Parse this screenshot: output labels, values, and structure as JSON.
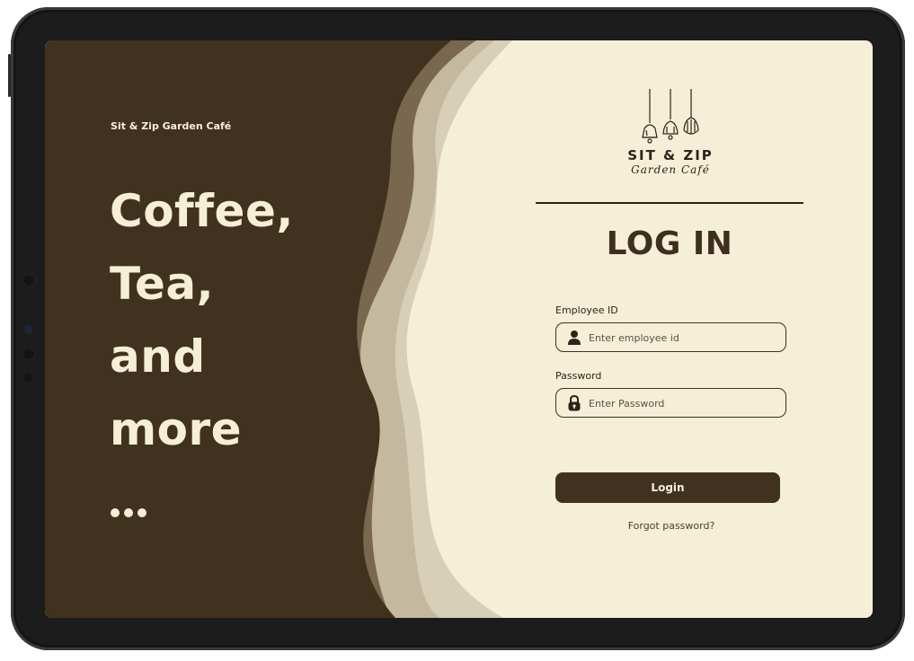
{
  "brand": {
    "name": "Sit & Zip Garden Café"
  },
  "hero": {
    "lines": [
      "Coffee,",
      "Tea,",
      "and",
      "more"
    ]
  },
  "logo": {
    "title": "SIT & ZIP",
    "script": "Garden Café"
  },
  "login": {
    "title": "LOG IN",
    "employee_id": {
      "label": "Employee ID",
      "placeholder": "Enter employee id",
      "value": "",
      "icon": "user-icon"
    },
    "password": {
      "label": "Password",
      "placeholder": "Enter Password",
      "value": "",
      "icon": "lock-icon"
    },
    "submit_label": "Login",
    "forgot_label": "Forgot password?"
  },
  "colors": {
    "dark_brown": "#41321f",
    "cream": "#f6efd8",
    "wave_mid": "#6f5c45",
    "wave_light": "#c9bea6"
  }
}
